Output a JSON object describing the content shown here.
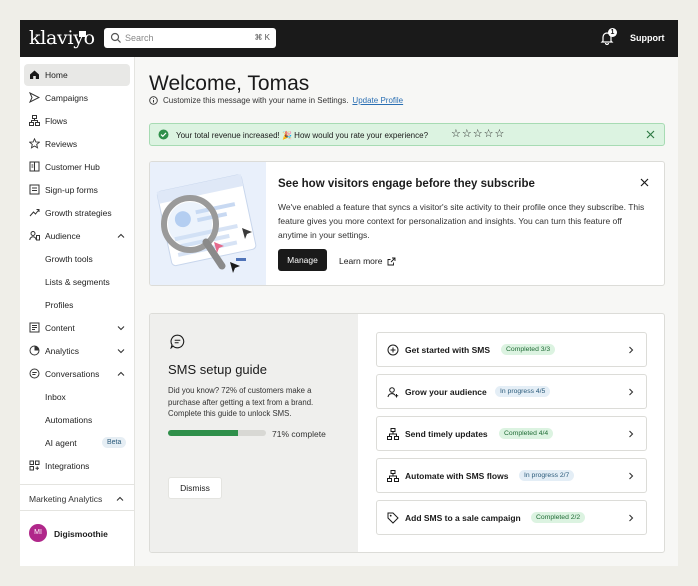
{
  "topbar": {
    "logo": "klaviyo",
    "search_placeholder": "Search",
    "search_shortcut": "⌘ K",
    "notification_count": "1",
    "support_label": "Support"
  },
  "sidebar": {
    "items": [
      {
        "label": "Home",
        "icon": "home-icon",
        "active": true
      },
      {
        "label": "Campaigns",
        "icon": "send-icon"
      },
      {
        "label": "Flows",
        "icon": "flow-icon"
      },
      {
        "label": "Reviews",
        "icon": "star-icon"
      },
      {
        "label": "Customer Hub",
        "icon": "book-icon"
      },
      {
        "label": "Sign-up forms",
        "icon": "form-icon"
      },
      {
        "label": "Growth strategies",
        "icon": "trend-icon"
      },
      {
        "label": "Audience",
        "icon": "people-icon",
        "expanded": true
      },
      {
        "label": "Growth tools",
        "sub": true
      },
      {
        "label": "Lists & segments",
        "sub": true
      },
      {
        "label": "Profiles",
        "sub": true
      },
      {
        "label": "Content",
        "icon": "content-icon",
        "collapsed": true
      },
      {
        "label": "Analytics",
        "icon": "pie-icon",
        "collapsed": true
      },
      {
        "label": "Conversations",
        "icon": "chat-icon",
        "expanded": true
      },
      {
        "label": "Inbox",
        "sub": true
      },
      {
        "label": "Automations",
        "sub": true
      },
      {
        "label": "AI agent",
        "sub": true,
        "badge": "Beta"
      },
      {
        "label": "Integrations",
        "icon": "integrations-icon"
      }
    ],
    "section_label": "Marketing Analytics",
    "account_initials": "MI",
    "account_name": "Digismoothie"
  },
  "main": {
    "title": "Welcome, Tomas",
    "subtitle": "Customize this message with your name in Settings.",
    "subtitle_link": "Update Profile",
    "banner": {
      "message": "Your total revenue increased! 🎉 How would you rate your experience?",
      "stars": [
        "☆",
        "☆",
        "☆",
        "☆",
        "☆"
      ]
    },
    "feature_card": {
      "title": "See how visitors engage before they subscribe",
      "body": "We've enabled a feature that syncs a visitor's site activity to their profile once they subscribe. This feature gives you more context for personalization and insights. You can turn this feature off anytime in your settings.",
      "manage_label": "Manage",
      "learn_label": "Learn more"
    },
    "sms_guide": {
      "title": "SMS setup guide",
      "body": "Did you know? 72% of customers make a purchase after getting a text from a brand. Complete this guide to unlock SMS.",
      "progress": 71,
      "progress_label": "71% complete",
      "dismiss_label": "Dismiss",
      "steps": [
        {
          "label": "Get started with SMS",
          "badge": "Completed 3/3",
          "status": "done",
          "icon": "plus-circle-icon"
        },
        {
          "label": "Grow your audience",
          "badge": "In progress 4/5",
          "status": "progress",
          "icon": "person-add-icon"
        },
        {
          "label": "Send timely updates",
          "badge": "Completed 4/4",
          "status": "done",
          "icon": "flow-icon"
        },
        {
          "label": "Automate with SMS flows",
          "badge": "In progress 2/7",
          "status": "progress",
          "icon": "flow-icon"
        },
        {
          "label": "Add SMS to a sale campaign",
          "badge": "Completed 2/2",
          "status": "done",
          "icon": "tag-icon"
        }
      ]
    }
  }
}
